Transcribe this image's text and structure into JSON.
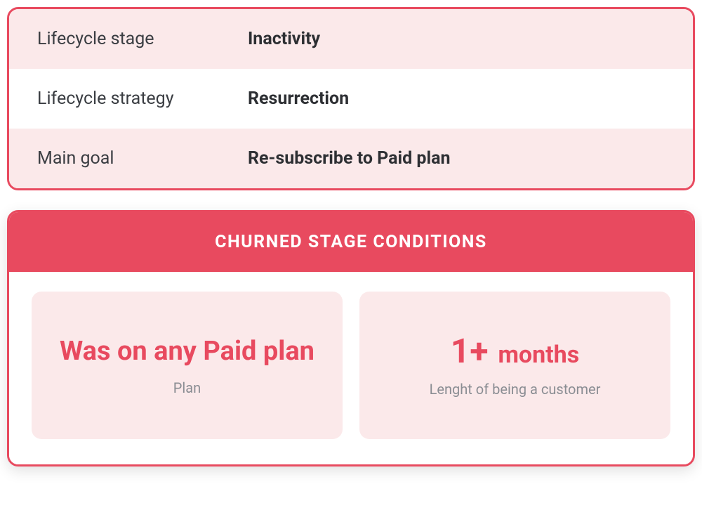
{
  "colors": {
    "accent": "#e84a5f",
    "tint": "#fbe9ea",
    "text_dark": "#2d2f33",
    "text_muted": "#8a8d93"
  },
  "info": {
    "stage_label": "Lifecycle stage",
    "stage_value": "Inactivity",
    "strategy_label": "Lifecycle strategy",
    "strategy_value": "Resurrection",
    "goal_label": "Main goal",
    "goal_value": "Re-subscribe to Paid plan"
  },
  "conditions": {
    "header": "CHURNED STAGE CONDITIONS",
    "left": {
      "title": "Was on any Paid plan",
      "sub": "Plan"
    },
    "right": {
      "title_big": "1+",
      "title_small": "months",
      "sub": "Lenght of being a customer"
    }
  }
}
